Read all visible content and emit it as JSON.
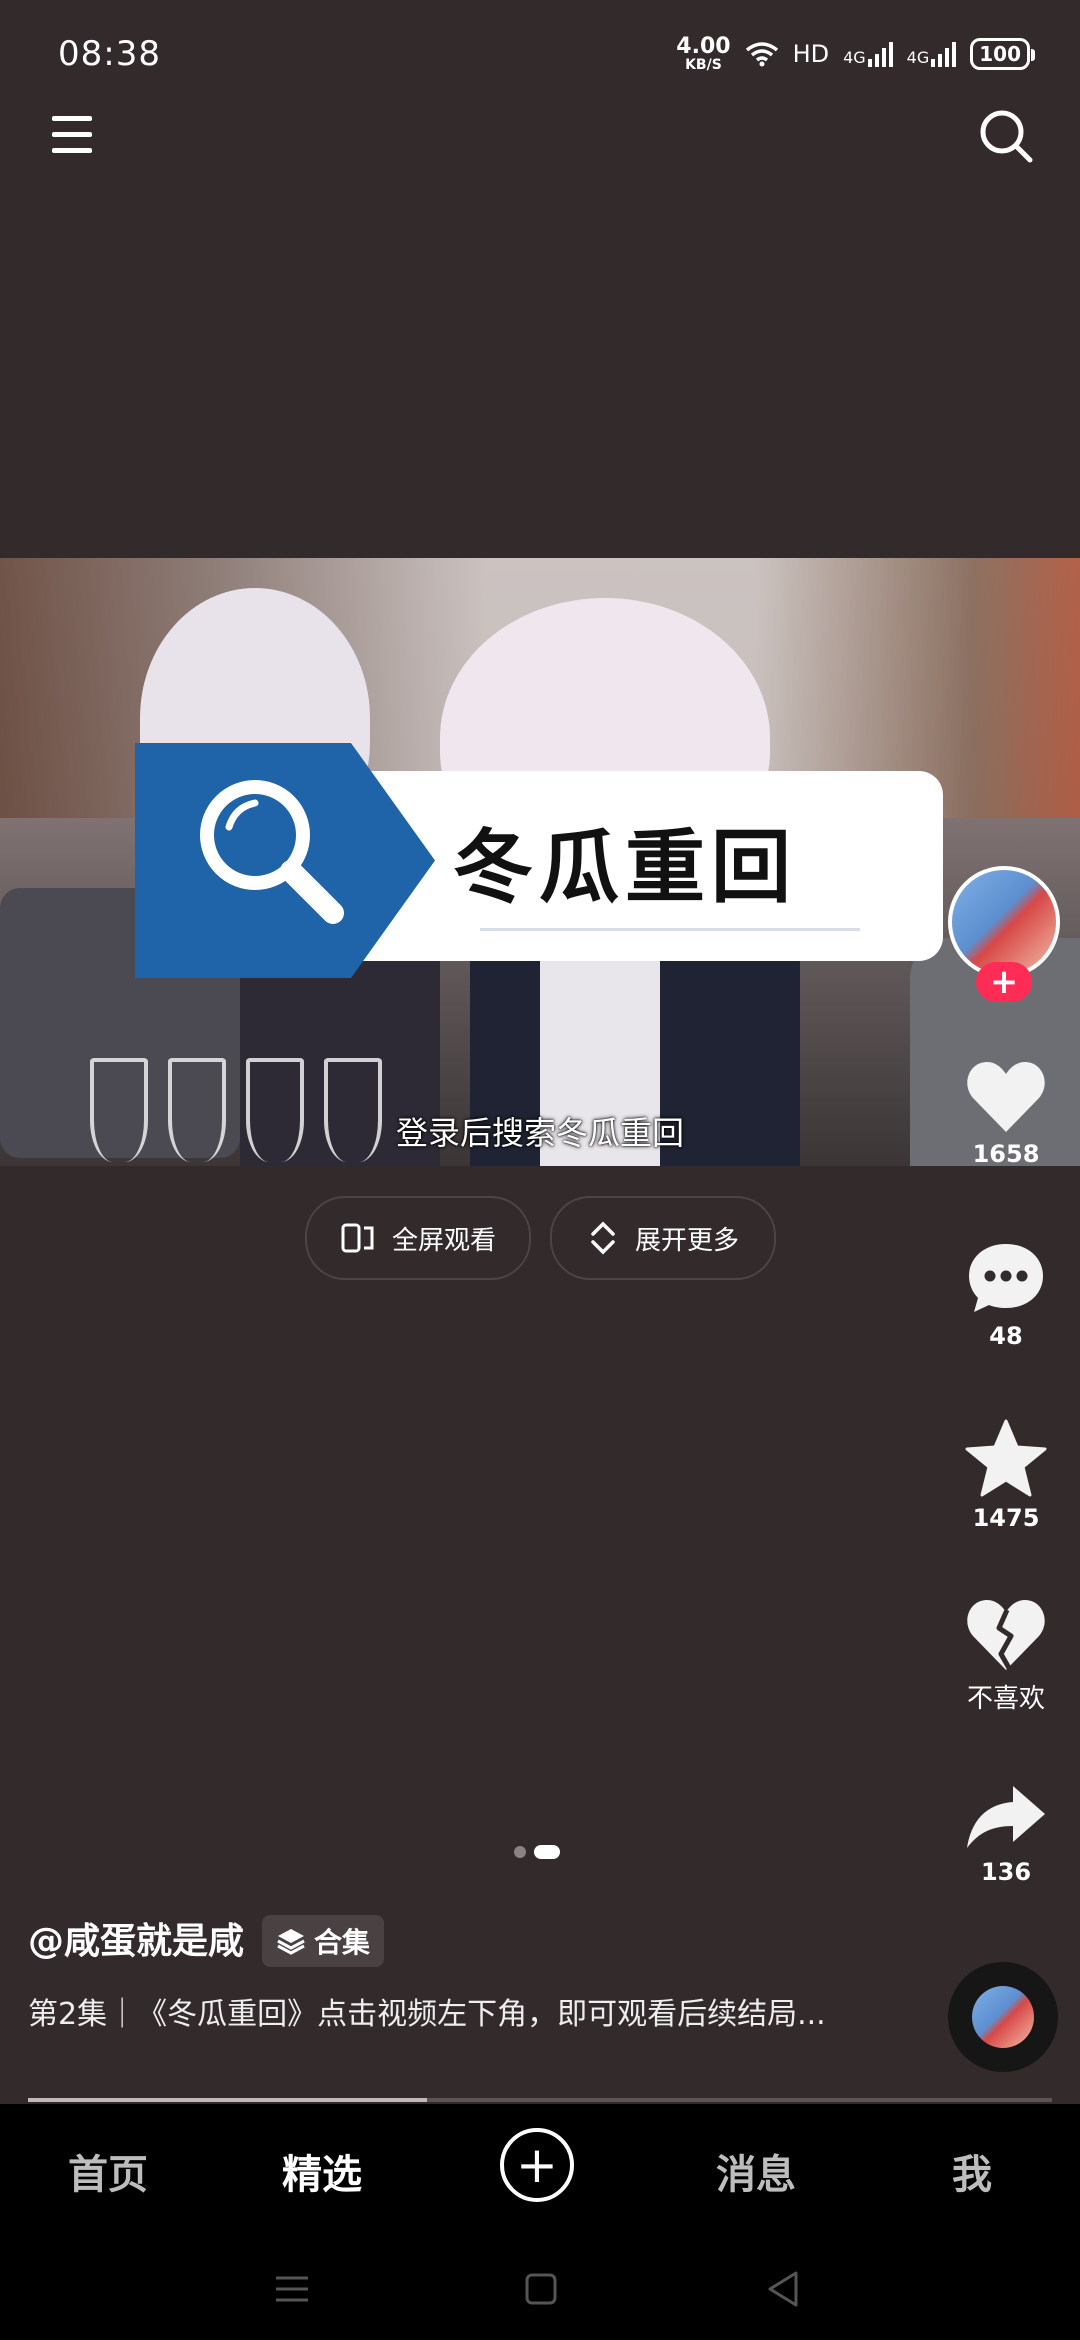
{
  "status_bar": {
    "time": "08:38",
    "net_speed": "4.00",
    "net_unit": "KB/S",
    "hd": "HD",
    "signal1": "4G",
    "signal2": "4G",
    "battery": "100"
  },
  "video": {
    "banner_title": "冬瓜重回",
    "subtitle": "登录后搜索冬瓜重回"
  },
  "actions": {
    "fullscreen_label": "全屏观看",
    "expand_label": "展开更多"
  },
  "rail": {
    "like_count": "1658",
    "comment_count": "48",
    "favorite_count": "1475",
    "dislike_label": "不喜欢",
    "share_count": "136"
  },
  "caption": {
    "author": "@咸蛋就是咸",
    "collection_tag": "合集",
    "description": "第2集｜《冬瓜重回》点击视频左下角，即可观看后续结局..."
  },
  "pager": {
    "current": 2,
    "total": 2
  },
  "progress": {
    "fraction": 0.39
  },
  "bottom_nav": {
    "items": [
      "首页",
      "精选",
      "消息",
      "我"
    ],
    "active": "精选"
  },
  "icons": [
    "menu-icon",
    "search-icon",
    "wifi-icon",
    "heart-icon",
    "comment-icon",
    "star-icon",
    "broken-heart-icon",
    "share-icon",
    "layers-icon",
    "fullscreen-icon",
    "expand-icon",
    "plus-icon"
  ]
}
